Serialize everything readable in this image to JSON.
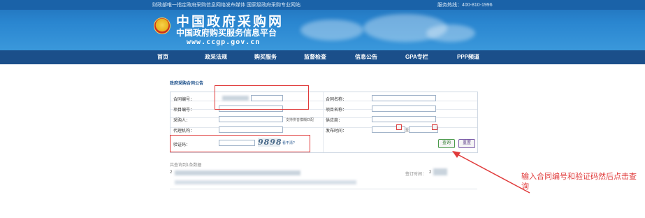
{
  "topbar": {
    "left_text": "财政部唯一指定政府采购信息网络发布媒体 国家级政府采购专业网站",
    "right_text": "服务热线：400-810-1996"
  },
  "logo": {
    "title": "中国政府采购网",
    "subtitle": "中国政府购买服务信息平台",
    "url": "www.ccgp.gov.cn"
  },
  "nav": {
    "items": [
      "首页",
      "政采法规",
      "购买服务",
      "监督检查",
      "信息公告",
      "GPA专栏",
      "PPP频道"
    ]
  },
  "form": {
    "title": "政府采购合同公告",
    "labels": {
      "contract_no": "合同编号：",
      "contract_name": "合同名称：",
      "project_no": "项目编号：",
      "project_name": "项目名称：",
      "purchaser": "采购人：",
      "supplier": "供应商：",
      "agency": "代理机构：",
      "publish_time": "发布时间：",
      "captcha": "验证码："
    },
    "fuzzy_hint": "支持拼音模糊匹配",
    "date_separator": "至",
    "captcha_text": "9898",
    "cant_see": "看不清?",
    "query_button": "查询",
    "reset_button": "重置"
  },
  "results": {
    "count_text": "共查询到1条数据",
    "sign_label": "签订时间：",
    "sign_value_prefix": "2"
  },
  "annotation": {
    "text": "输入合同编号和验证码然后点击查询",
    "color": "#e03a3a"
  },
  "colors": {
    "header": "#2a86d0",
    "nav": "#1b4f8a",
    "annotation": "#e03a3a"
  }
}
